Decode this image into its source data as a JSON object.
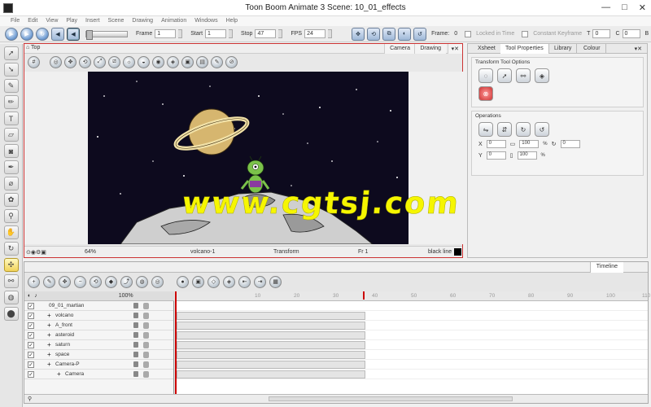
{
  "window": {
    "title": "Toon Boom Animate 3 Scene: 10_01_effects",
    "min": "—",
    "max": "□",
    "close": "✕"
  },
  "menu": [
    "File",
    "Edit",
    "View",
    "Play",
    "Insert",
    "Scene",
    "Drawing",
    "Animation",
    "Windows",
    "Help"
  ],
  "toolbar": {
    "frame_label": "Frame",
    "frame_value": "1",
    "start_label": "Start",
    "start_value": "1",
    "stop_label": "Stop",
    "stop_value": "47",
    "fps_label": "FPS",
    "fps_value": "24",
    "right_frame_label": "Frame:",
    "right_frame_value": "0",
    "locked_label": "Locked in Time",
    "constant_label": "Constant Keyframe",
    "t_label": "T",
    "t_value": "0",
    "c_label": "C",
    "c_value": "0",
    "b_label": "B"
  },
  "view": {
    "title": "Top",
    "tabs": [
      "Camera",
      "Drawing"
    ],
    "status": {
      "zoom": "64%",
      "layer": "volcano-1",
      "mode": "Transform",
      "frame": "Fr 1",
      "color": "black line"
    }
  },
  "right_panel": {
    "tabs": [
      "Xsheet",
      "Tool Properties",
      "Library",
      "Colour"
    ],
    "transform_title": "Transform Tool Options",
    "operations_title": "Operations",
    "fields": {
      "x": "0",
      "y": "0",
      "sx": "100",
      "sy": "100",
      "rot": "0",
      "pct": "%"
    }
  },
  "timeline": {
    "tab": "Timeline",
    "zoom": "100%",
    "ruler": [
      "10",
      "20",
      "30",
      "40",
      "50",
      "60",
      "70",
      "80",
      "90",
      "100",
      "110"
    ],
    "layers": [
      {
        "name": "09_01_martian",
        "indent": 0
      },
      {
        "name": "volcano",
        "indent": 1
      },
      {
        "name": "A_front",
        "indent": 1
      },
      {
        "name": "asteroid",
        "indent": 1
      },
      {
        "name": "saturn",
        "indent": 1
      },
      {
        "name": "space",
        "indent": 1
      },
      {
        "name": "Camera-P",
        "indent": 1
      },
      {
        "name": "Camera",
        "indent": 2
      }
    ]
  },
  "watermark": "www.cgtsj.com"
}
